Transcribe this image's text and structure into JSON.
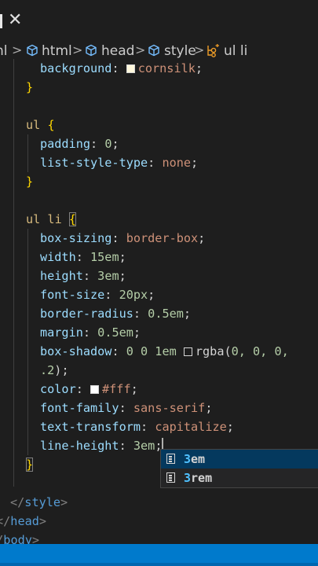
{
  "tab": {
    "close_glyph": "✕"
  },
  "breadcrumb": {
    "items": [
      {
        "label": "nl",
        "icon": ""
      },
      {
        "label": "html",
        "icon": "cube-icon"
      },
      {
        "label": "head",
        "icon": "cube-icon"
      },
      {
        "label": "style",
        "icon": "cube-icon"
      },
      {
        "label": "ul li",
        "icon": "selector-icon"
      }
    ],
    "separator": ">"
  },
  "code": {
    "l1_prop": "background",
    "l1_colon": ": ",
    "l1_val": "cornsilk",
    "l1_semi": ";",
    "l2_brace": "}",
    "l4_sel": "ul",
    "l4_brace": "{",
    "l5_prop": "padding",
    "l5_colon": ": ",
    "l5_val": "0",
    "l5_semi": ";",
    "l6_prop": "list-style-type",
    "l6_colon": ": ",
    "l6_val": "none",
    "l6_semi": ";",
    "l7_brace": "}",
    "l9_sel": "ul li",
    "l9_brace": "{",
    "l10_prop": "box-sizing",
    "l10_colon": ": ",
    "l10_val": "border-box",
    "l10_semi": ";",
    "l11_prop": "width",
    "l11_colon": ": ",
    "l11_val": "15em",
    "l11_semi": ";",
    "l12_prop": "height",
    "l12_colon": ": ",
    "l12_val": "3em",
    "l12_semi": ";",
    "l13_prop": "font-size",
    "l13_colon": ": ",
    "l13_val": "20px",
    "l13_semi": ";",
    "l14_prop": "border-radius",
    "l14_colon": ": ",
    "l14_val": "0.5em",
    "l14_semi": ";",
    "l15_prop": "margin",
    "l15_colon": ": ",
    "l15_val": "0.5em",
    "l15_semi": ";",
    "l16_prop": "box-shadow",
    "l16_colon": ": ",
    "l16_val1": "0 0 1em ",
    "l16_fn": "rgba(",
    "l16_nums": "0, 0, 0,",
    "l17_num": ".2",
    "l17_close": ");",
    "l18_prop": "color",
    "l18_colon": ": ",
    "l18_val": "#fff",
    "l18_semi": ";",
    "l19_prop": "font-family",
    "l19_colon": ": ",
    "l19_val": "sans-serif",
    "l19_semi": ";",
    "l20_prop": "text-transform",
    "l20_colon": ": ",
    "l20_val": "capitalize",
    "l20_semi": ";",
    "l21_prop": "line-height",
    "l21_colon": ": ",
    "l21_val": "3em",
    "l21_semi": ";",
    "l22_brace": "}",
    "l24_open": "</",
    "l24_tag": "style",
    "l24_close": ">",
    "l25_open": "</",
    "l25_tag": "head",
    "l25_close": ">",
    "l26_open": "</",
    "l26_tag": "body",
    "l26_close": ">"
  },
  "swatches": {
    "cornsilk": "#fff8dc",
    "black_alpha": "#000000",
    "white": "#ffffff"
  },
  "suggestions": [
    {
      "match": "3",
      "rest": "em",
      "selected": true,
      "icon": "unit-icon"
    },
    {
      "match": "3",
      "rest": "rem",
      "selected": false,
      "icon": "unit-icon"
    }
  ],
  "colors": {
    "background": "#1e1e1e",
    "statusbar": "#007acc",
    "selector": "#d7ba7d",
    "property": "#9cdcfe",
    "value": "#ce9178",
    "number": "#b5cea8",
    "tag": "#569cd6"
  }
}
